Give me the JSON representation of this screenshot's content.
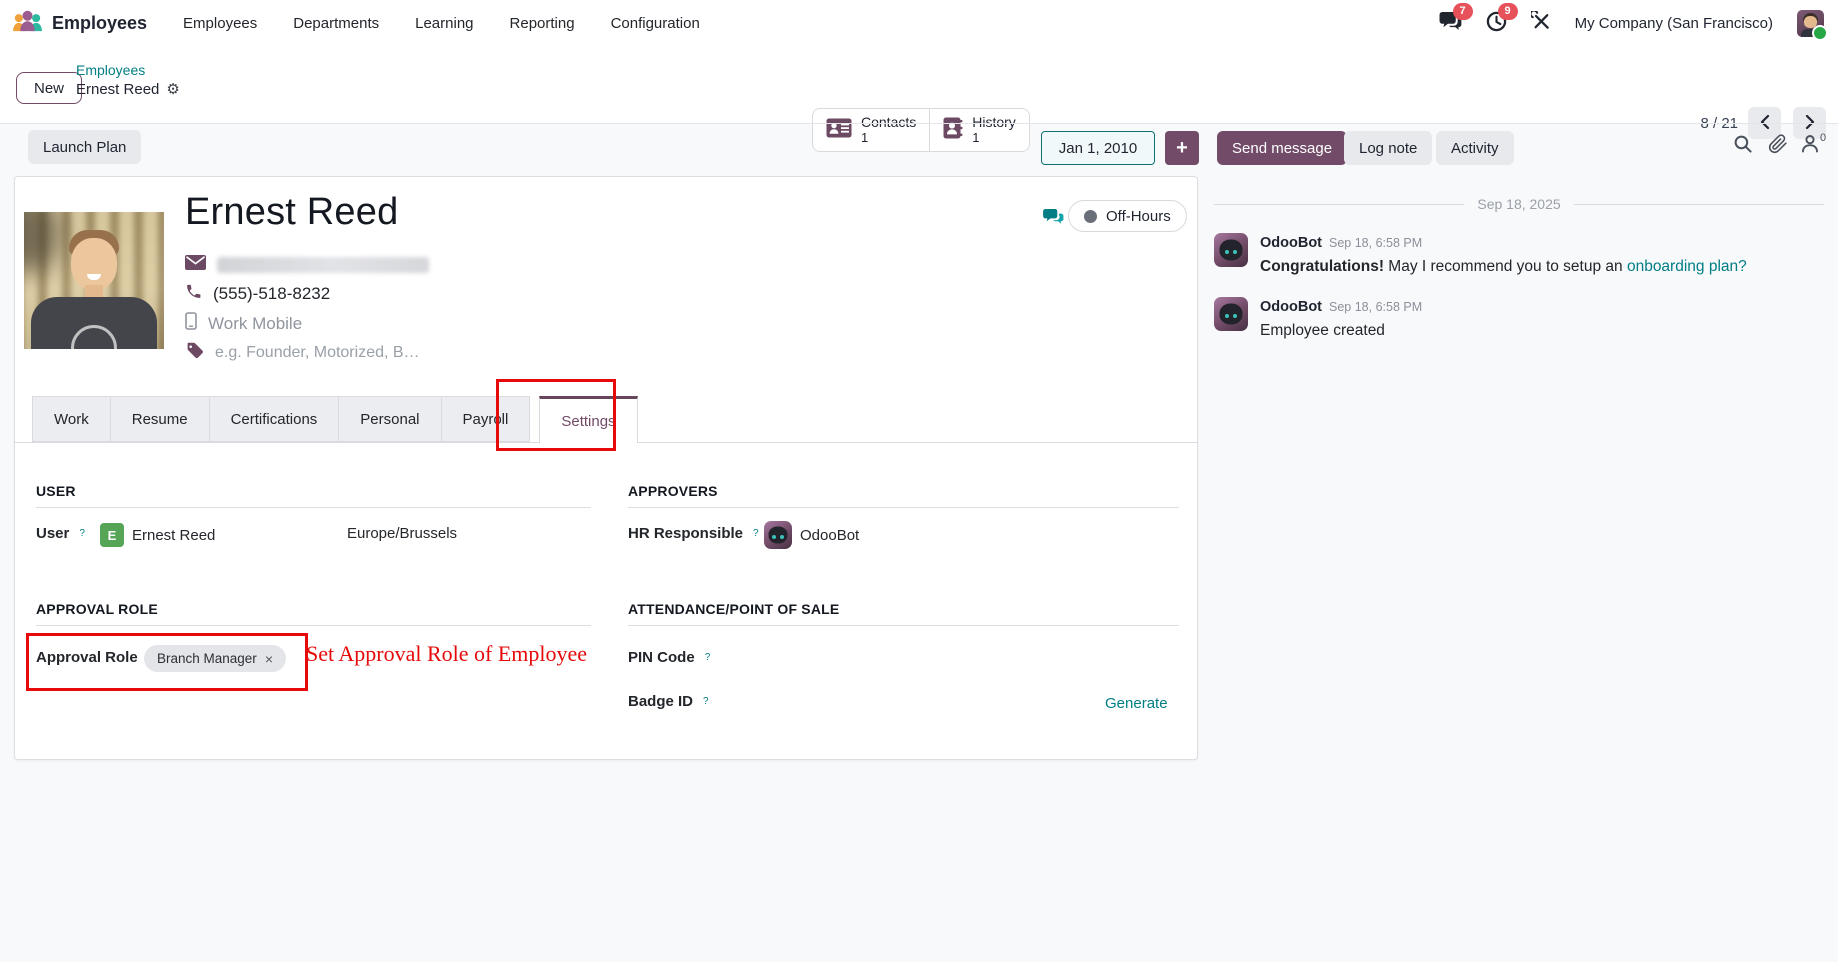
{
  "nav": {
    "brand": "Employees",
    "menu": [
      "Employees",
      "Departments",
      "Learning",
      "Reporting",
      "Configuration"
    ],
    "messages_badge": "7",
    "activities_badge": "9",
    "company": "My Company (San Francisco)"
  },
  "breadcrumb": {
    "new_button": "New",
    "parent": "Employees",
    "current": "Ernest Reed"
  },
  "stat_buttons": [
    {
      "label": "Contacts",
      "count": "1"
    },
    {
      "label": "History",
      "count": "1"
    }
  ],
  "pager": {
    "value": "8 / 21"
  },
  "action_bar": {
    "launch_plan": "Launch Plan",
    "date": "Jan 1, 2010",
    "send_message": "Send message",
    "log_note": "Log note",
    "activity": "Activity",
    "followers_count": "0"
  },
  "employee": {
    "name": "Ernest Reed",
    "phone": "(555)-518-8232",
    "mobile_placeholder": "Work Mobile",
    "tags_placeholder": "e.g. Founder, Motorized, B…",
    "status": "Off-Hours"
  },
  "tabs": [
    "Work",
    "Resume",
    "Certifications",
    "Personal",
    "Payroll",
    "Settings"
  ],
  "settings": {
    "user_section": "USER",
    "user_label": "User",
    "user_avatar_letter": "E",
    "user_value": "Ernest Reed",
    "timezone": "Europe/Brussels",
    "approvers_section": "APPROVERS",
    "hr_responsible_label": "HR Responsible",
    "hr_responsible_value": "OdooBot",
    "approval_section": "APPROVAL ROLE",
    "approval_role_label": "Approval Role",
    "approval_role_tag": "Branch Manager",
    "attendance_section": "ATTENDANCE/POINT OF SALE",
    "pin_code_label": "PIN Code",
    "badge_id_label": "Badge ID",
    "generate_link": "Generate"
  },
  "annotation": {
    "note": "Set Approval Role of Employee"
  },
  "chatter": {
    "date_divider": "Sep 18, 2025",
    "messages": [
      {
        "author": "OdooBot",
        "time": "Sep 18, 6:58 PM",
        "lead": "Congratulations!",
        "body": " May I recommend you to setup an ",
        "link": "onboarding plan?"
      },
      {
        "author": "OdooBot",
        "time": "Sep 18, 6:58 PM",
        "body": "Employee created"
      }
    ]
  },
  "icons": {
    "gear": "⚙",
    "plus": "+",
    "remove": "×"
  },
  "ui": {
    "help_marker": "?"
  },
  "colors": {
    "primary_purple": "#714B67",
    "accent_teal": "#017e84",
    "annotation_red": "#e60a0a",
    "badge_red": "#e7515a",
    "user_avatar_green": "#56a456",
    "presence_green": "#28a745"
  }
}
